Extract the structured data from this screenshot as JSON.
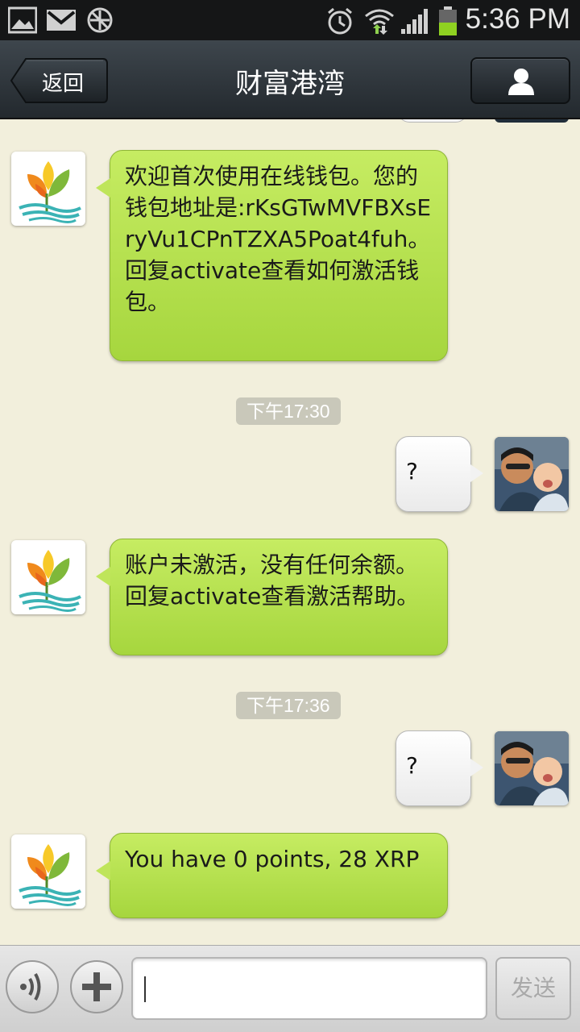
{
  "status_bar": {
    "time": "5:36 PM",
    "icons": [
      "gallery-icon",
      "gmail-icon",
      "app-icon",
      "alarm-icon",
      "wifi-icon",
      "signal-icon",
      "battery-icon"
    ]
  },
  "header": {
    "back_label": "返回",
    "title": "财富港湾",
    "profile_icon": "person-icon"
  },
  "messages": [
    {
      "type": "incoming",
      "text": "欢迎首次使用在线钱包。您的钱包地址是:rKsGTwMVFBXsEryVu1CPnTZXA5Poat4fuh。回复activate查看如何激活钱包。"
    },
    {
      "type": "timestamp",
      "text": "下午17:30"
    },
    {
      "type": "outgoing",
      "text": "?"
    },
    {
      "type": "incoming",
      "text": "账户未激活，没有任何余额。回复activate查看激活帮助。"
    },
    {
      "type": "timestamp",
      "text": "下午17:36"
    },
    {
      "type": "outgoing",
      "text": "?"
    },
    {
      "type": "incoming",
      "text": "You have 0 points, 28 XRP"
    }
  ],
  "input_bar": {
    "voice_icon": "voice-icon",
    "plus_icon": "plus-icon",
    "input_value": "",
    "send_label": "发送"
  },
  "colors": {
    "background": "#f2efdc",
    "incoming_bubble": "#b5e04e",
    "outgoing_bubble": "#f5f5f5",
    "header": "#2f363c"
  }
}
